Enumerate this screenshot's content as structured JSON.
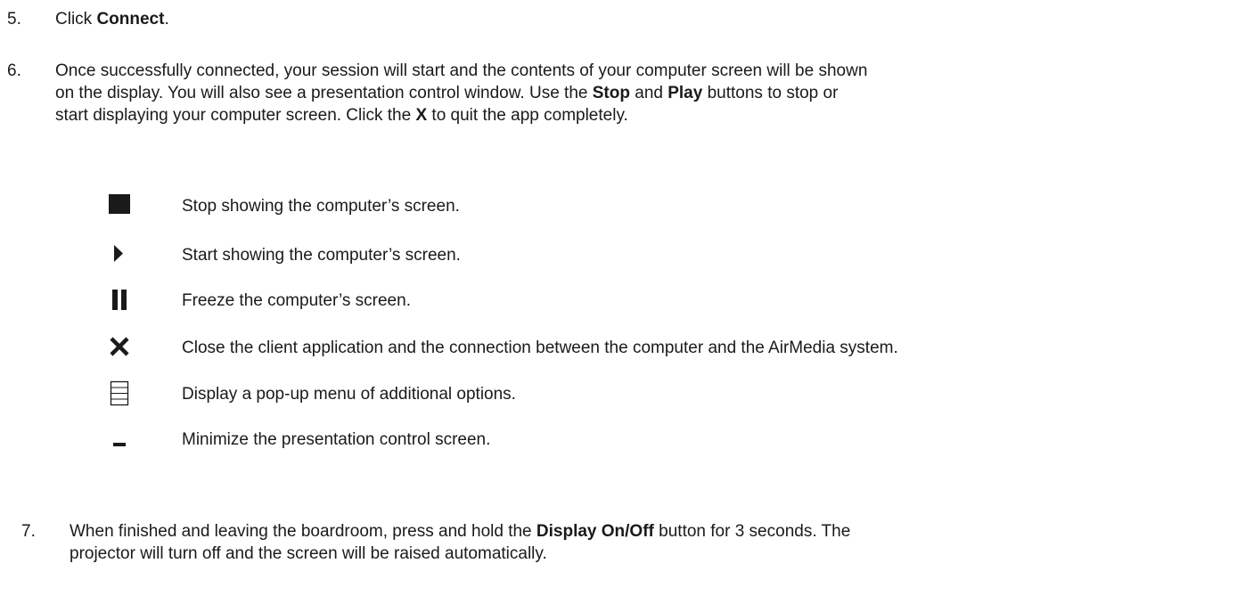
{
  "step5": {
    "number": "5.",
    "prefix": "Click ",
    "bold": "Connect",
    "suffix": "."
  },
  "step6": {
    "number": "6.",
    "line1": "Once successfully connected, your session will start and the contents of your computer screen will be shown",
    "line2_pre": "on the display.  You will also see a presentation control window.  Use the ",
    "stop_bold": "Stop",
    "and": " and ",
    "play_bold": "Play",
    "line2_post": " buttons to stop or",
    "line3_pre": "start displaying your computer screen. Click the ",
    "x_bold": "X",
    "line3_post": " to quit the app completely."
  },
  "icons": [
    {
      "icon": "stop-icon",
      "description": "Stop showing the computer’s screen."
    },
    {
      "icon": "play-icon",
      "description": "Start showing the computer’s screen."
    },
    {
      "icon": "pause-icon",
      "description": "Freeze the computer’s screen."
    },
    {
      "icon": "close-x-icon",
      "description": "Close the client application and the connection between the computer and the AirMedia system."
    },
    {
      "icon": "menu-icon",
      "description": "Display a pop-up menu of additional options."
    },
    {
      "icon": "minimize-icon",
      "description": "Minimize the presentation control screen."
    }
  ],
  "step7": {
    "number": "7.",
    "line1_pre": "When finished and leaving the boardroom, press and hold the ",
    "bold": "Display On/Off",
    "line1_post": " button for 3 seconds.  The",
    "line2": "projector will turn off and the screen will be raised automatically."
  }
}
